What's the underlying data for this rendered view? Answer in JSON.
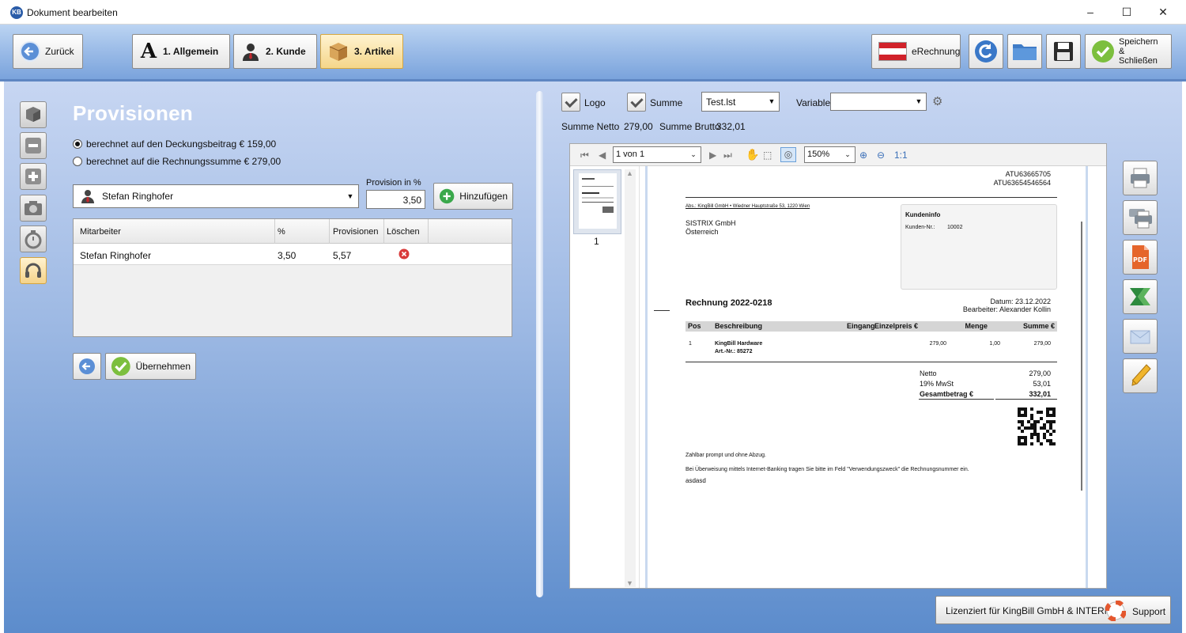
{
  "window": {
    "title": "Dokument bearbeiten",
    "app_icon": "KB",
    "minimize": "–",
    "maximize": "☐",
    "close": "✕"
  },
  "toolbar": {
    "back": "Zurück",
    "tabs": [
      {
        "label": "1. Allgemein"
      },
      {
        "label": "2. Kunde"
      },
      {
        "label": "3. Artikel"
      }
    ],
    "erechnung": "eRechnung",
    "save_close": "Speichern\n& Schließen"
  },
  "commission": {
    "title": "Provisionen",
    "radio1": "berechnet auf den Deckungsbeitrag € 159,00",
    "radio2": "berechnet auf die Rechnungssumme € 279,00",
    "selected_employee": "Stefan Ringhofer",
    "rate_label": "Provision in %",
    "rate_value": "3,50",
    "add_button": "Hinzufügen",
    "columns": [
      "Mitarbeiter",
      "%",
      "Provisionen",
      "Löschen"
    ],
    "rows": [
      {
        "employee": "Stefan Ringhofer",
        "percent": "3,50",
        "amount": "5,57"
      }
    ],
    "apply_button": "Übernehmen"
  },
  "preview": {
    "logo_label": "Logo",
    "sum_label": "Summe",
    "template": "Test.lst",
    "variable_label": "Variable",
    "variable_value": "",
    "summe_netto_label": "Summe Netto",
    "summe_netto": "279,00",
    "summe_brutto_label": "Summe Brutto",
    "summe_brutto": "332,01",
    "page_indicator": "1 von 1",
    "zoom": "150%",
    "ratio": "1:1",
    "thumb_page": "1"
  },
  "invoice": {
    "ids": [
      "ATU63665705",
      "ATU63654546564"
    ],
    "sender_line": "Abs.: KingBill GmbH • Wiedner Hauptstraße 53, 1220 Wien",
    "recipient": [
      "SISTRIX GmbH",
      "Österreich"
    ],
    "kundeninfo_title": "Kundeninfo",
    "kunden_nr_label": "Kunden-Nr.:",
    "kunden_nr": "10002",
    "title": "Rechnung 2022-0218",
    "datum": "Datum: 23.12.2022",
    "bearbeiter": "Bearbeiter: Alexander Kollin",
    "table_headers": [
      "Pos",
      "Beschreibung",
      "Eingang",
      "Einzelpreis €",
      "Menge",
      "Summe €"
    ],
    "items": [
      {
        "pos": "1",
        "desc": "KingBill Hardware",
        "art": "Art.-Nr.: 85272",
        "price": "279,00",
        "qty": "1,00",
        "sum": "279,00"
      }
    ],
    "netto_label": "Netto",
    "netto": "279,00",
    "mwst_label": "19% MwSt",
    "mwst": "53,01",
    "gesamt_label": "Gesamtbetrag €",
    "gesamt": "332,01",
    "payment_note": "Zahlbar prompt und ohne Abzug.",
    "transfer_note": "Bei Überweisung mittels Internet-Banking tragen Sie bitte im Feld \"Verwendungszweck\" die Rechnungsnummer ein.",
    "extra": "asdasd"
  },
  "footer": {
    "license": "Lizenziert für KingBill GmbH & INTERN",
    "support": "Support"
  },
  "colors": {
    "toolbar_top": "#bcd4f2",
    "panel_bottom": "#5c8ccc",
    "active_tab": "#f5d68a",
    "delete_red": "#d93b3b",
    "add_green": "#3aa84b",
    "austria_red": "#d1222a"
  }
}
